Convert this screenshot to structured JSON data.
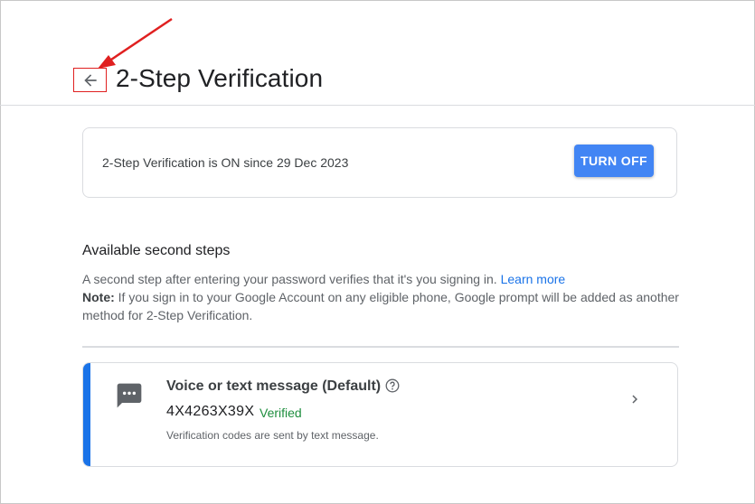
{
  "header": {
    "title": "2-Step Verification",
    "back_icon": "arrow-left-icon"
  },
  "status": {
    "text": "2-Step Verification is ON since 29 Dec 2023",
    "button_label": "TURN OFF",
    "button_color": "#4285f4"
  },
  "second_steps": {
    "title": "Available second steps",
    "desc_text": "A second step after entering your password verifies that it's you signing in. ",
    "learn_more": "Learn more",
    "note_label": "Note:",
    "note_text": " If you sign in to your Google Account on any eligible phone, Google prompt will be added as another method for 2-Step Verification."
  },
  "method": {
    "title": "Voice or text message (Default)",
    "phone": "4X4263X39X",
    "verified": "Verified",
    "subtitle": "Verification codes are sent by text message.",
    "accent_color": "#1a73e8",
    "icon": "message-icon"
  },
  "annotation": {
    "color": "#e02020"
  }
}
